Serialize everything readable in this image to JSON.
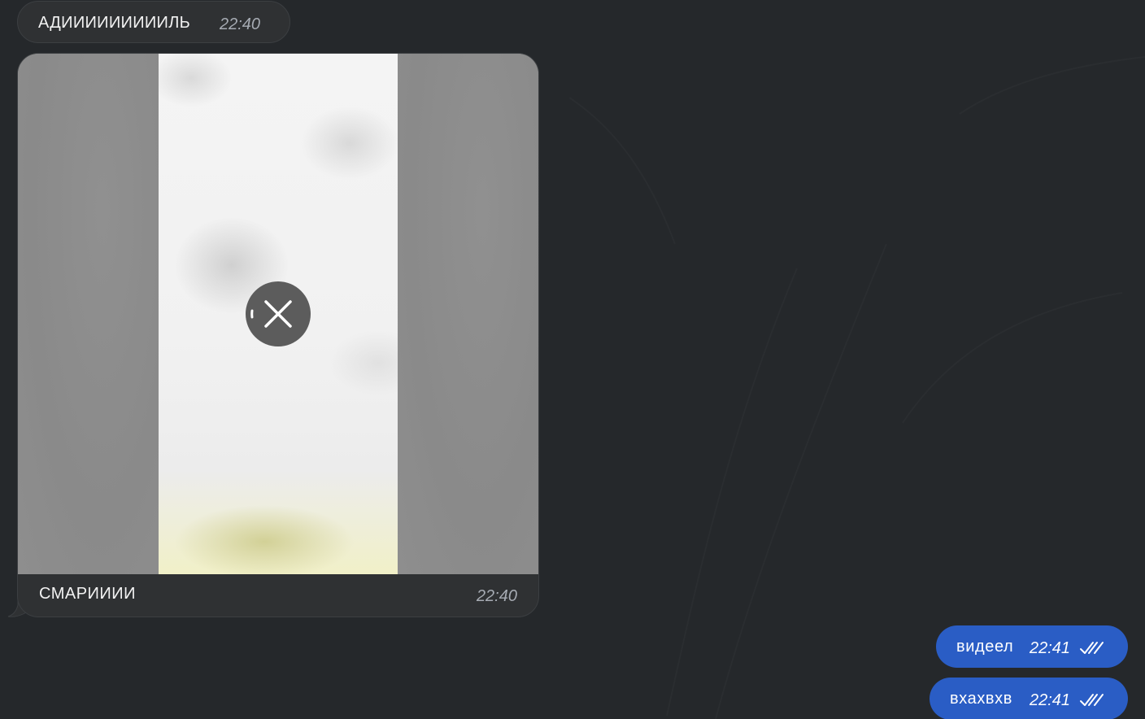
{
  "messages": {
    "incoming_text": {
      "text": "АДИИИИИИИИИЛЬ",
      "time": "22:40"
    },
    "incoming_media": {
      "caption": "СМАРИИИИ",
      "time": "22:40",
      "download_state": "cancel-download-icon"
    },
    "outgoing": [
      {
        "text": "видеел",
        "time": "22:41",
        "status_icon": "double-check-icon"
      },
      {
        "text": "вхахвхв",
        "time": "22:41",
        "status_icon": "double-check-icon"
      }
    ]
  },
  "colors": {
    "background": "#25282b",
    "incoming_bubble": "#2f3133",
    "outgoing_bubble": "#2a5dc5",
    "time_incoming": "#a6abb3"
  }
}
